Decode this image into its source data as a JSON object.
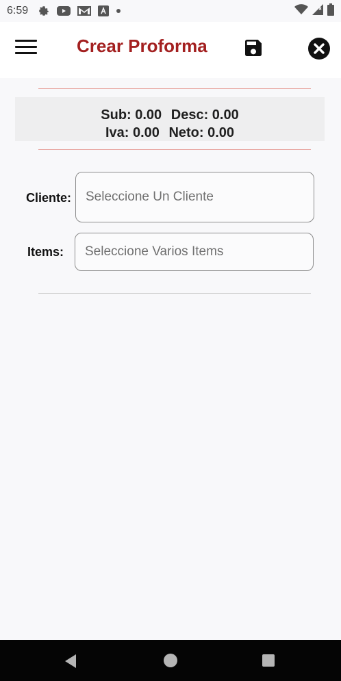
{
  "status_bar": {
    "time": "6:59",
    "icons": [
      "gear-icon",
      "youtube-icon",
      "gmail-icon",
      "font-a-icon",
      "dot-icon",
      "wifi-icon",
      "signal-icon",
      "battery-icon"
    ]
  },
  "app_bar": {
    "title": "Crear Proforma",
    "title_color": "#a32020",
    "menu_icon": "hamburger-menu-icon",
    "save_icon": "floppy-disk-icon",
    "close_icon": "close-circle-icon"
  },
  "summary": {
    "sub": "Sub: 0.00",
    "desc": "Desc: 0.00",
    "iva": "Iva: 0.00",
    "neto": "Neto: 0.00"
  },
  "form": {
    "cliente_label": "Cliente:",
    "cliente_placeholder": "Seleccione Un Cliente",
    "items_label": "Items:",
    "items_placeholder": "Seleccione Varios Items"
  },
  "nav_bar": {
    "icons": [
      "back-icon",
      "home-icon",
      "recents-icon"
    ]
  }
}
